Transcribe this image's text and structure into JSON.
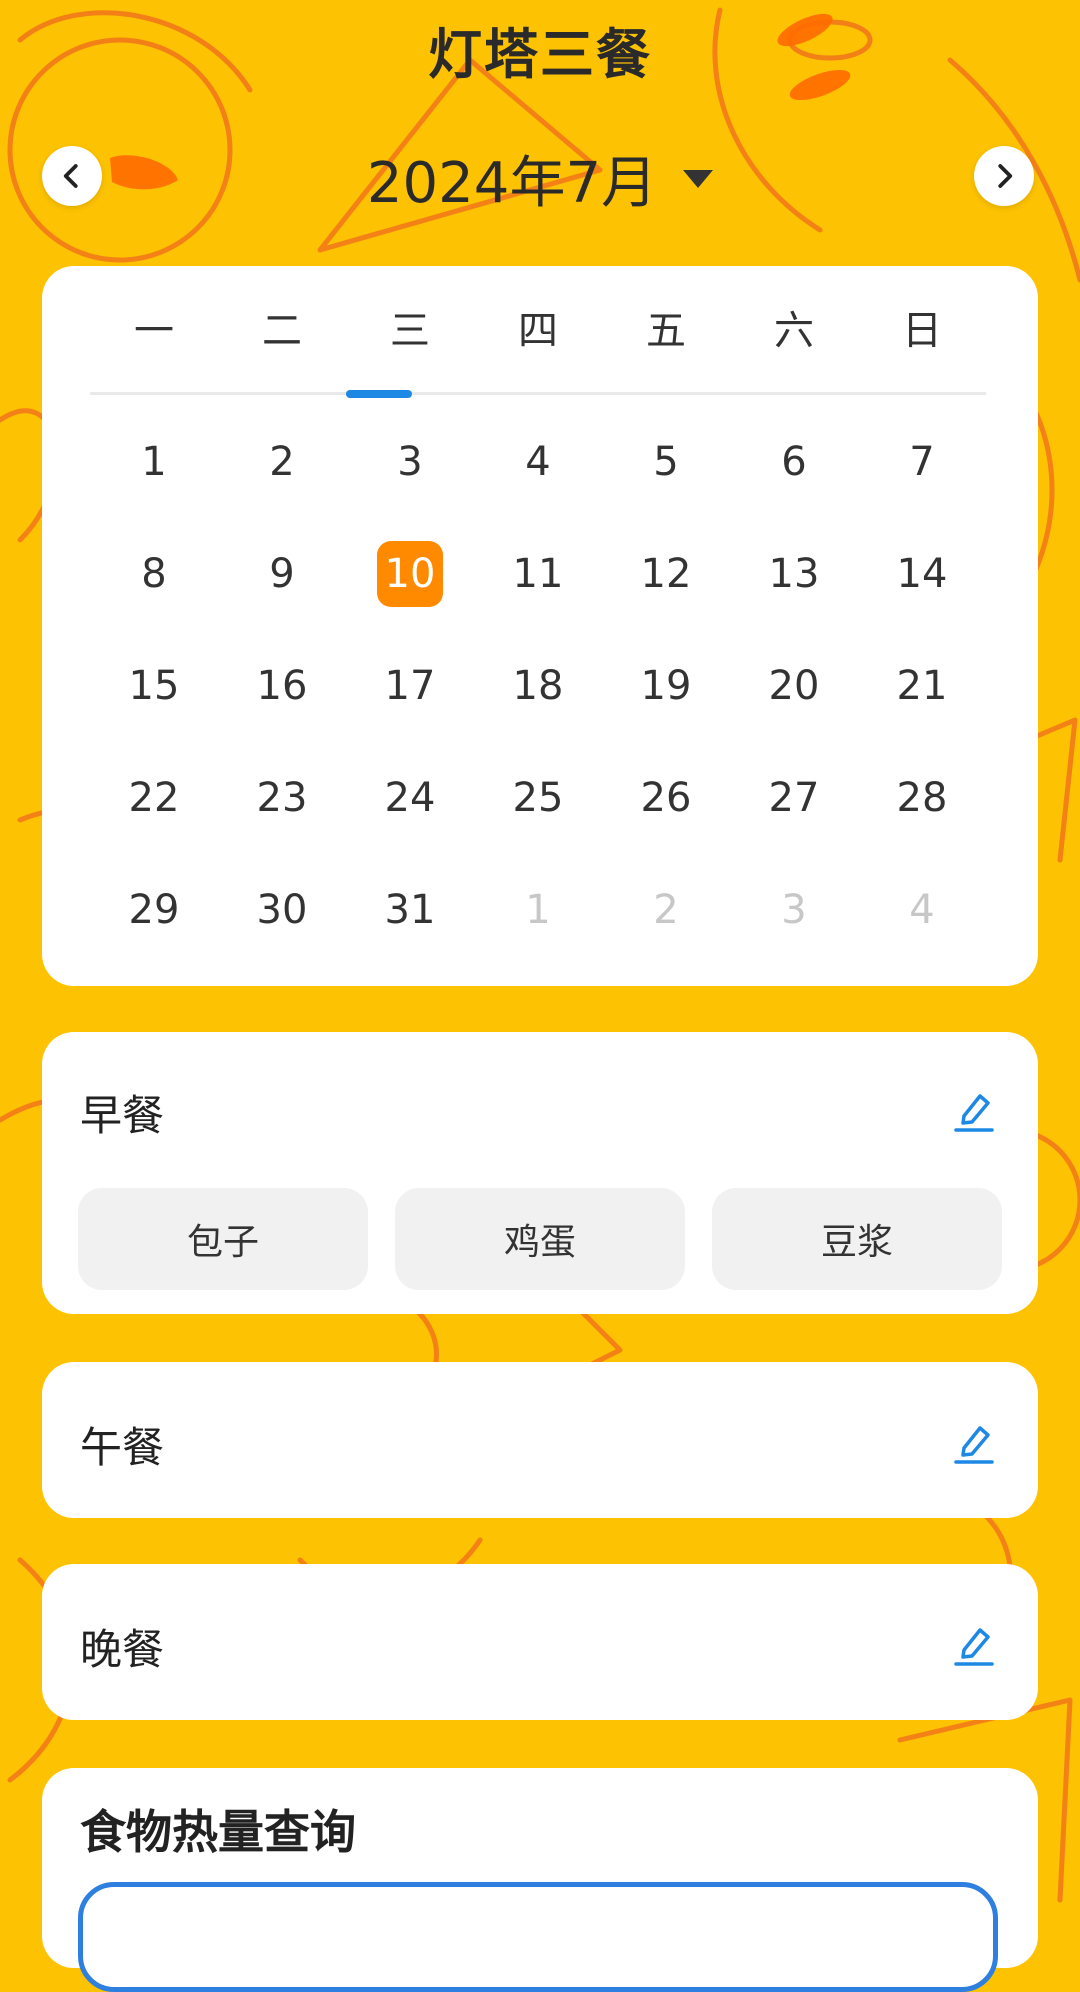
{
  "app": {
    "title": "灯塔三餐"
  },
  "header": {
    "month_label": "2024年7月",
    "icons": {
      "prev": "chevron-left-icon",
      "next": "chevron-right-icon",
      "dropdown": "caret-down-icon"
    }
  },
  "calendar": {
    "weekdays": [
      "一",
      "二",
      "三",
      "四",
      "五",
      "六",
      "日"
    ],
    "selected_weekday_index": 2,
    "weeks": [
      [
        {
          "d": "1"
        },
        {
          "d": "2"
        },
        {
          "d": "3"
        },
        {
          "d": "4"
        },
        {
          "d": "5"
        },
        {
          "d": "6"
        },
        {
          "d": "7"
        }
      ],
      [
        {
          "d": "8"
        },
        {
          "d": "9"
        },
        {
          "d": "10",
          "today": true
        },
        {
          "d": "11"
        },
        {
          "d": "12"
        },
        {
          "d": "13"
        },
        {
          "d": "14"
        }
      ],
      [
        {
          "d": "15"
        },
        {
          "d": "16"
        },
        {
          "d": "17"
        },
        {
          "d": "18"
        },
        {
          "d": "19"
        },
        {
          "d": "20"
        },
        {
          "d": "21"
        }
      ],
      [
        {
          "d": "22"
        },
        {
          "d": "23"
        },
        {
          "d": "24"
        },
        {
          "d": "25"
        },
        {
          "d": "26"
        },
        {
          "d": "27"
        },
        {
          "d": "28"
        }
      ],
      [
        {
          "d": "29"
        },
        {
          "d": "30"
        },
        {
          "d": "31"
        },
        {
          "d": "1",
          "muted": true
        },
        {
          "d": "2",
          "muted": true
        },
        {
          "d": "3",
          "muted": true
        },
        {
          "d": "4",
          "muted": true
        }
      ]
    ],
    "colors": {
      "today_bg": "#ff8a00",
      "indicator": "#1e88e5"
    }
  },
  "meals": {
    "breakfast": {
      "title": "早餐",
      "items": [
        "包子",
        "鸡蛋",
        "豆浆"
      ]
    },
    "lunch": {
      "title": "午餐"
    },
    "dinner": {
      "title": "晚餐"
    },
    "edit_icon": "pencil-edit-icon"
  },
  "calorie_lookup": {
    "title": "食物热量查询"
  }
}
